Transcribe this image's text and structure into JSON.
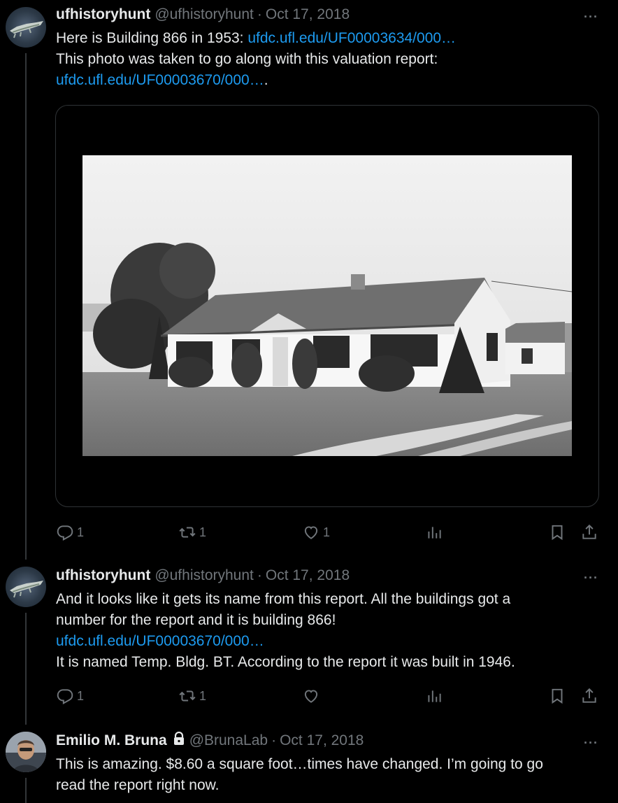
{
  "tweets": [
    {
      "name": "ufhistoryhunt",
      "handle": "@ufhistoryhunt",
      "date": "Oct 17, 2018",
      "lines": [
        [
          {
            "t": "Here is Building 866 in 1953: ",
            "link": false
          },
          {
            "t": "ufdc.ufl.edu/UF00003634/000…",
            "link": true
          }
        ],
        [
          {
            "t": "This photo was taken to go along with this valuation report:",
            "link": false
          }
        ],
        [
          {
            "t": "ufdc.ufl.edu/UF00003670/000…",
            "link": true
          },
          {
            "t": ".",
            "link": false
          }
        ]
      ],
      "actions": {
        "reply": "1",
        "retweet": "1",
        "like": "1",
        "views": ""
      }
    },
    {
      "name": "ufhistoryhunt",
      "handle": "@ufhistoryhunt",
      "date": "Oct 17, 2018",
      "lines": [
        [
          {
            "t": "And it looks like it gets its name from this report.  All the buildings got a",
            "link": false
          }
        ],
        [
          {
            "t": "number for the report and it is building 866!",
            "link": false
          }
        ],
        [
          {
            "t": "ufdc.ufl.edu/UF00003670/000…",
            "link": true
          }
        ],
        [
          {
            "t": "It is named Temp. Bldg. BT.  According to the report it was built in 1946.",
            "link": false
          }
        ]
      ],
      "actions": {
        "reply": "1",
        "retweet": "1",
        "like": "",
        "views": ""
      }
    },
    {
      "name": "Emilio M. Bruna",
      "handle": "@BrunaLab",
      "date": "Oct 17, 2018",
      "lines": [
        [
          {
            "t": "This is amazing. $8.60 a square foot…times have changed.  I’m going to go",
            "link": false
          }
        ],
        [
          {
            "t": "read the report right now.",
            "link": false
          }
        ]
      ]
    }
  ],
  "separator": "·",
  "more_label": "···",
  "colors": {
    "link": "#1d9bf0",
    "muted": "#71767b",
    "text": "#e7e9ea",
    "background": "#000000"
  },
  "icons": {
    "reply": "reply-icon",
    "retweet": "retweet-icon",
    "like": "heart-icon",
    "views": "views-chart-icon",
    "bookmark": "bookmark-icon",
    "share": "share-icon",
    "lock": "lock-icon"
  }
}
